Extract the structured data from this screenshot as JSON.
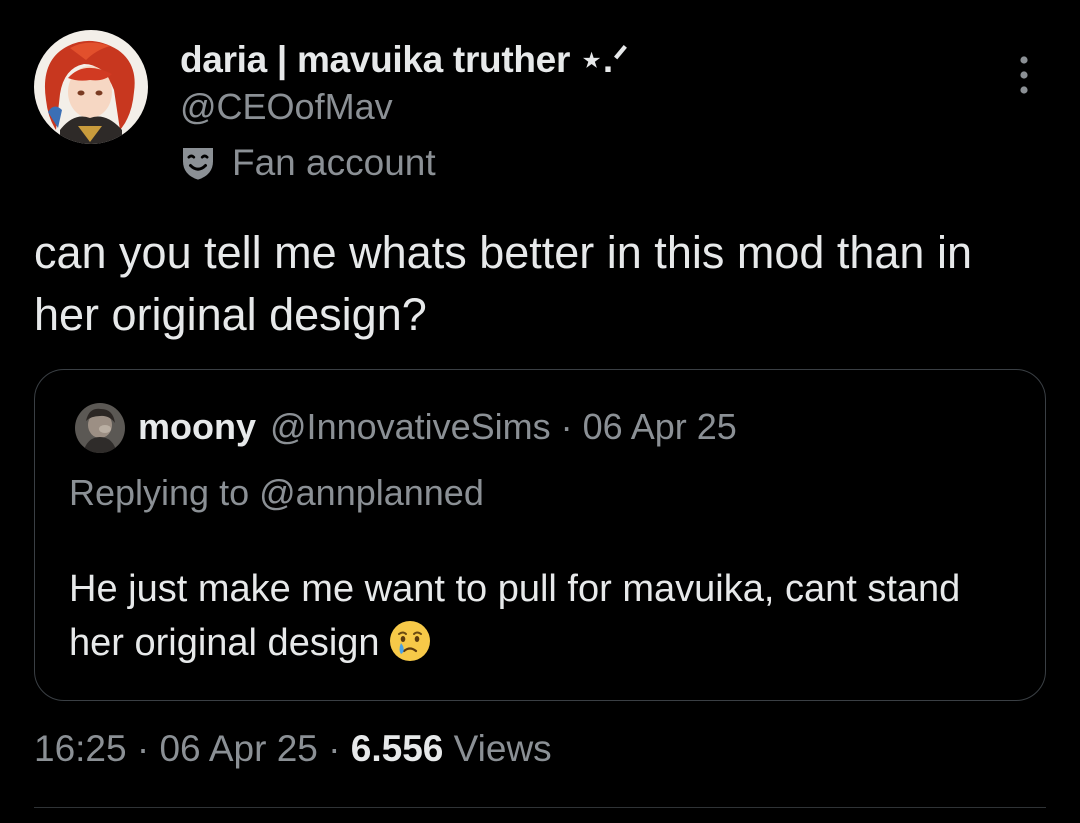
{
  "author": {
    "display_name": "daria | mavuika truther ⋆.ᐟ",
    "handle": "@CEOofMav",
    "label": "Fan account",
    "label_icon": "theater-mask-icon",
    "avatar_icon": "profile-avatar"
  },
  "tweet": {
    "text": "can you tell me whats better in this mod than in her original design?"
  },
  "quoted_tweet": {
    "author_name": "moony",
    "meta": "@InnovativeSims · 06 Apr 25",
    "replying_to": "Replying to @annplanned",
    "text": "He just make me want to pull for mavuika, cant stand her original design",
    "emoji": "crying-face-emoji"
  },
  "footer": {
    "time_date": "16:25 · 06 Apr 25 · ",
    "views_count": "6.556",
    "views_label": "Views"
  },
  "colors": {
    "background": "#000000",
    "primary_text": "#e7e9ea",
    "secondary_text": "#8b9095",
    "border": "#3a3f44"
  }
}
